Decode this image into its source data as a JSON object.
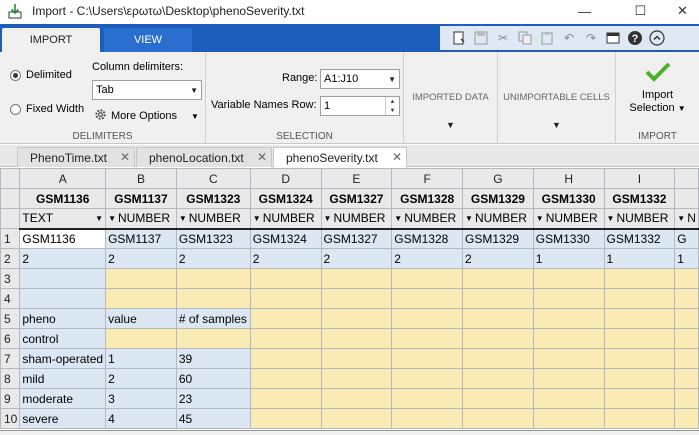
{
  "window": {
    "title": "Import - C:\\Users\\ερωτω\\Desktop\\phenoSeverity.txt",
    "min": "—",
    "max": "☐",
    "close": "✕"
  },
  "ribbon_tabs": [
    "IMPORT",
    "VIEW"
  ],
  "quick_access": [
    "new-document-icon",
    "save-icon",
    "cut-icon",
    "copy-icon",
    "paste-icon",
    "undo-icon",
    "redo-icon",
    "layout-icon",
    "help-icon",
    "collapse-icon"
  ],
  "delimiters": {
    "delimited": "Delimited",
    "fixed_width": "Fixed Width",
    "column_delims_label": "Column delimiters:",
    "delimiter_value": "Tab",
    "more_options": "More Options",
    "section_label": "DELIMITERS"
  },
  "selection": {
    "range_label": "Range:",
    "range_value": "A1:J10",
    "varnames_label": "Variable Names Row:",
    "varnames_value": "1",
    "section_label": "SELECTION"
  },
  "imported_data": {
    "label": "IMPORTED DATA"
  },
  "unimportable": {
    "label": "UNIMPORTABLE CELLS"
  },
  "import": {
    "button_line1": "Import",
    "button_line2": "Selection",
    "section_label": "IMPORT"
  },
  "file_tabs": [
    {
      "label": "PhenoTime.txt",
      "active": false
    },
    {
      "label": "phenoLocation.txt",
      "active": false
    },
    {
      "label": "phenoSeverity.txt",
      "active": true
    }
  ],
  "grid": {
    "column_letters": [
      "A",
      "B",
      "C",
      "D",
      "E",
      "F",
      "G",
      "H",
      "I",
      ""
    ],
    "variable_names": [
      "GSM1136",
      "GSM1137",
      "GSM1323",
      "GSM1324",
      "GSM1327",
      "GSM1328",
      "GSM1329",
      "GSM1330",
      "GSM1332",
      ""
    ],
    "types": [
      "TEXT",
      "NUMBER",
      "NUMBER",
      "NUMBER",
      "NUMBER",
      "NUMBER",
      "NUMBER",
      "NUMBER",
      "NUMBER",
      "N"
    ],
    "row_numbers": [
      "1",
      "2",
      "3",
      "4",
      "5",
      "6",
      "7",
      "8",
      "9",
      "10"
    ],
    "rows": [
      [
        "GSM1136",
        "GSM1137",
        "GSM1323",
        "GSM1324",
        "GSM1327",
        "GSM1328",
        "GSM1329",
        "GSM1330",
        "GSM1332",
        "G"
      ],
      [
        "2",
        "2",
        "2",
        "2",
        "2",
        "2",
        "2",
        "1",
        "1",
        "1"
      ],
      [
        "",
        "",
        "",
        "",
        "",
        "",
        "",
        "",
        "",
        ""
      ],
      [
        "",
        "",
        "",
        "",
        "",
        "",
        "",
        "",
        "",
        ""
      ],
      [
        "pheno",
        "value",
        "# of samples",
        "",
        "",
        "",
        "",
        "",
        "",
        ""
      ],
      [
        "control",
        "",
        "",
        "",
        "",
        "",
        "",
        "",
        "",
        ""
      ],
      [
        "sham-operated",
        "1",
        "39",
        "",
        "",
        "",
        "",
        "",
        "",
        ""
      ],
      [
        "mild",
        "2",
        "60",
        "",
        "",
        "",
        "",
        "",
        "",
        ""
      ],
      [
        "moderate",
        "3",
        "23",
        "",
        "",
        "",
        "",
        "",
        "",
        ""
      ],
      [
        "severe",
        "4",
        "45",
        "",
        "",
        "",
        "",
        "",
        "",
        ""
      ]
    ]
  }
}
